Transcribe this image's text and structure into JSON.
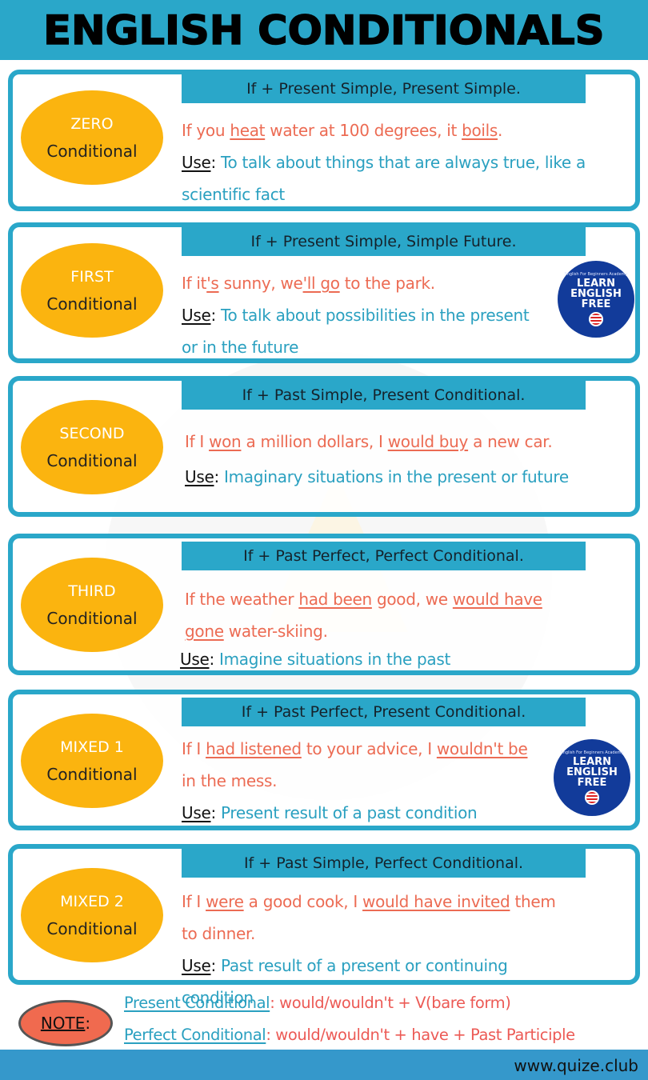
{
  "header": {
    "title": "ENGLISH CONDITIONALS"
  },
  "colors": {
    "accent": "#2aa7c9",
    "badge": "#fbb40f",
    "example_text": "#ec6b53",
    "use_text": "#2aa0c0",
    "logo": "#123b9a",
    "note_badge": "#f06a4f",
    "footer": "#3598cb"
  },
  "cards": [
    {
      "type": "ZERO",
      "word": "Conditional",
      "formula": "If + Present Simple, Present Simple.",
      "example": [
        {
          "t": "If you "
        },
        {
          "t": "heat",
          "u": true
        },
        {
          "t": " water at 100 degrees, it "
        },
        {
          "t": "boils",
          "u": true
        },
        {
          "t": "."
        }
      ],
      "use_label": "Use",
      "use_text": "To talk about things that are always true, like a scientific fact",
      "logo": false
    },
    {
      "type": "FIRST",
      "word": "Conditional",
      "formula": "If + Present Simple, Simple Future.",
      "example": [
        {
          "t": "If it"
        },
        {
          "t": "'s",
          "u": true
        },
        {
          "t": " sunny, we"
        },
        {
          "t": "'ll go",
          "u": true
        },
        {
          "t": " to the park."
        }
      ],
      "use_label": "Use",
      "use_text": "To talk about possibilities in the present or in the future",
      "logo": true
    },
    {
      "type": "SECOND",
      "word": "Conditional",
      "formula": "If + Past Simple, Present Conditional.",
      "example": [
        {
          "t": "If I "
        },
        {
          "t": "won",
          "u": true
        },
        {
          "t": " a million dollars, I "
        },
        {
          "t": "would buy",
          "u": true
        },
        {
          "t": " a new car."
        }
      ],
      "use_label": "Use",
      "use_text": "Imaginary situations in the present or future",
      "logo": false
    },
    {
      "type": "THIRD",
      "word": "Conditional",
      "formula": "If + Past Perfect, Perfect Conditional.",
      "example": [
        {
          "t": "If the weather "
        },
        {
          "t": "had been",
          "u": true
        },
        {
          "t": " good, we "
        },
        {
          "t": "would have gone",
          "u": true
        },
        {
          "t": " water-skiing."
        }
      ],
      "use_label": "Use",
      "use_text": "Imagine situations in the past",
      "logo": false
    },
    {
      "type": "MIXED 1",
      "word": "Conditional",
      "formula": "If + Past Perfect, Present Conditional.",
      "example": [
        {
          "t": "If I "
        },
        {
          "t": "had listened",
          "u": true
        },
        {
          "t": " to your advice, I "
        },
        {
          "t": "wouldn't be",
          "u": true
        },
        {
          "t": " in the mess."
        }
      ],
      "use_label": "Use",
      "use_text": "Present result of a past condition",
      "logo": true
    },
    {
      "type": "MIXED 2",
      "word": "Conditional",
      "formula": "If + Past Simple, Perfect Conditional.",
      "example": [
        {
          "t": "If I "
        },
        {
          "t": "were",
          "u": true
        },
        {
          "t": " a good cook, I "
        },
        {
          "t": "would have invited",
          "u": true
        },
        {
          "t": " them to dinner."
        }
      ],
      "use_label": "Use",
      "use_text": "Past result of a present or continuing condition",
      "logo": false
    }
  ],
  "logo": {
    "small": "English For Beginners Academy",
    "lines": [
      "LEARN",
      "ENGLISH",
      "FREE"
    ]
  },
  "note": {
    "label": "NOTE",
    "colon": ":",
    "items": [
      {
        "term": "Present Conditional",
        "def": "would/wouldn't + V(bare form)"
      },
      {
        "term": "Perfect Conditional",
        "def": "would/wouldn't + have + Past Participle"
      }
    ]
  },
  "footer": {
    "url": "www.quize.club"
  }
}
